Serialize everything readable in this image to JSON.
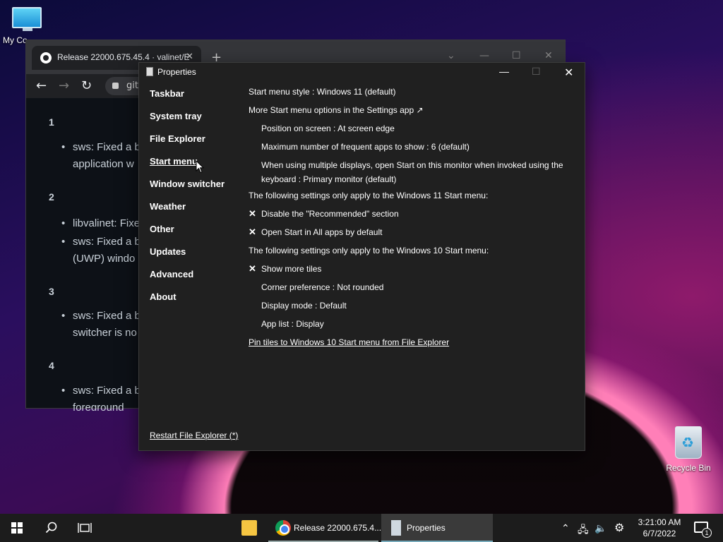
{
  "desktop": {
    "icon_my_computer": "My Co",
    "icon_recycle_bin": "Recycle Bin"
  },
  "browser": {
    "tab_title": "Release 22000.675.45.4 · valinet/E",
    "address_partial": "git",
    "content": [
      {
        "num": "1",
        "items": [
          "sws: Fixed a b\napplication w"
        ]
      },
      {
        "num": "2",
        "items": [
          "libvalinet: Fixe",
          "sws: Fixed a b\n(UWP) windo"
        ]
      },
      {
        "num": "3",
        "items": [
          "sws: Fixed a b\nswitcher is no"
        ]
      },
      {
        "num": "4",
        "items": [
          "sws: Fixed a b\nforeground"
        ]
      }
    ]
  },
  "properties": {
    "title": "Properties",
    "sidebar": [
      {
        "label": "Taskbar"
      },
      {
        "label": "System tray"
      },
      {
        "label": "File Explorer"
      },
      {
        "label": "Start menu"
      },
      {
        "label": "Window switcher"
      },
      {
        "label": "Weather"
      },
      {
        "label": "Other"
      },
      {
        "label": "Updates"
      },
      {
        "label": "Advanced"
      },
      {
        "label": "About"
      }
    ],
    "restart_link": "Restart File Explorer (*)",
    "options": [
      {
        "text": "Start menu style : Windows 11 (default)"
      },
      {
        "text": "More Start menu options in the Settings app ↗"
      },
      {
        "text": "Position on screen : At screen edge"
      },
      {
        "text": "Maximum number of frequent apps to show : 6 (default)"
      },
      {
        "text": "When using multiple displays, open Start on this monitor when invoked using the keyboard : Primary monitor (default)"
      },
      {
        "text": "The following settings only apply to the Windows 11 Start menu:"
      },
      {
        "text": "Disable the \"Recommended\" section"
      },
      {
        "text": "Open Start in All apps by default"
      },
      {
        "text": "The following settings only apply to the Windows 10 Start menu:"
      },
      {
        "text": "Show more tiles"
      },
      {
        "text": "Corner preference : Not rounded"
      },
      {
        "text": "Display mode : Default"
      },
      {
        "text": "App list : Display"
      },
      {
        "text": "Pin tiles to Windows 10 Start menu from File Explorer"
      }
    ],
    "check_mark": "✕"
  },
  "taskbar": {
    "apps": [
      {
        "label": ""
      },
      {
        "label": "Release 22000.675.4..."
      },
      {
        "label": "Properties"
      }
    ],
    "time": "3:21:00 AM",
    "date": "6/7/2022",
    "notification_count": "1"
  }
}
